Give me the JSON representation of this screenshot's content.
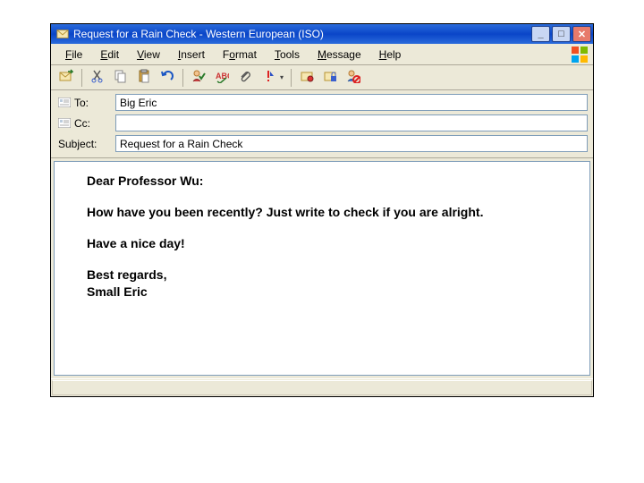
{
  "window": {
    "title": "Request for a Rain Check - Western European (ISO)"
  },
  "menu": {
    "file": {
      "label": "File",
      "ul": "F"
    },
    "edit": {
      "label": "Edit",
      "ul": "E"
    },
    "view": {
      "label": "View",
      "ul": "V"
    },
    "insert": {
      "label": "Insert",
      "ul": "I"
    },
    "format": {
      "label": "Format",
      "ul": "o"
    },
    "tools": {
      "label": "Tools",
      "ul": "T"
    },
    "message": {
      "label": "Message",
      "ul": "M"
    },
    "help": {
      "label": "Help",
      "ul": "H"
    }
  },
  "toolbar_icons": {
    "send": "send-icon",
    "cut": "cut-icon",
    "copy": "copy-icon",
    "paste": "paste-icon",
    "undo": "undo-icon",
    "check_names": "check-names-icon",
    "spelling": "spelling-icon",
    "attach": "attach-icon",
    "priority": "priority-icon",
    "sign": "sign-icon",
    "encrypt": "encrypt-icon",
    "offline": "offline-icon"
  },
  "headers": {
    "to_label": "To:",
    "to_value": "Big Eric",
    "cc_label": "Cc:",
    "cc_value": "",
    "subject_label": "Subject:",
    "subject_value": "Request for a Rain Check"
  },
  "body": {
    "p1": "Dear Professor Wu:",
    "p2": "How have you been recently? Just write to check if you are alright.",
    "p3": "Have a nice day!",
    "p4": "Best regards,",
    "p5": "Small Eric"
  },
  "colors": {
    "titlebar": "#0a45c8",
    "chrome": "#ece9d8",
    "input_border": "#7f9db9"
  }
}
